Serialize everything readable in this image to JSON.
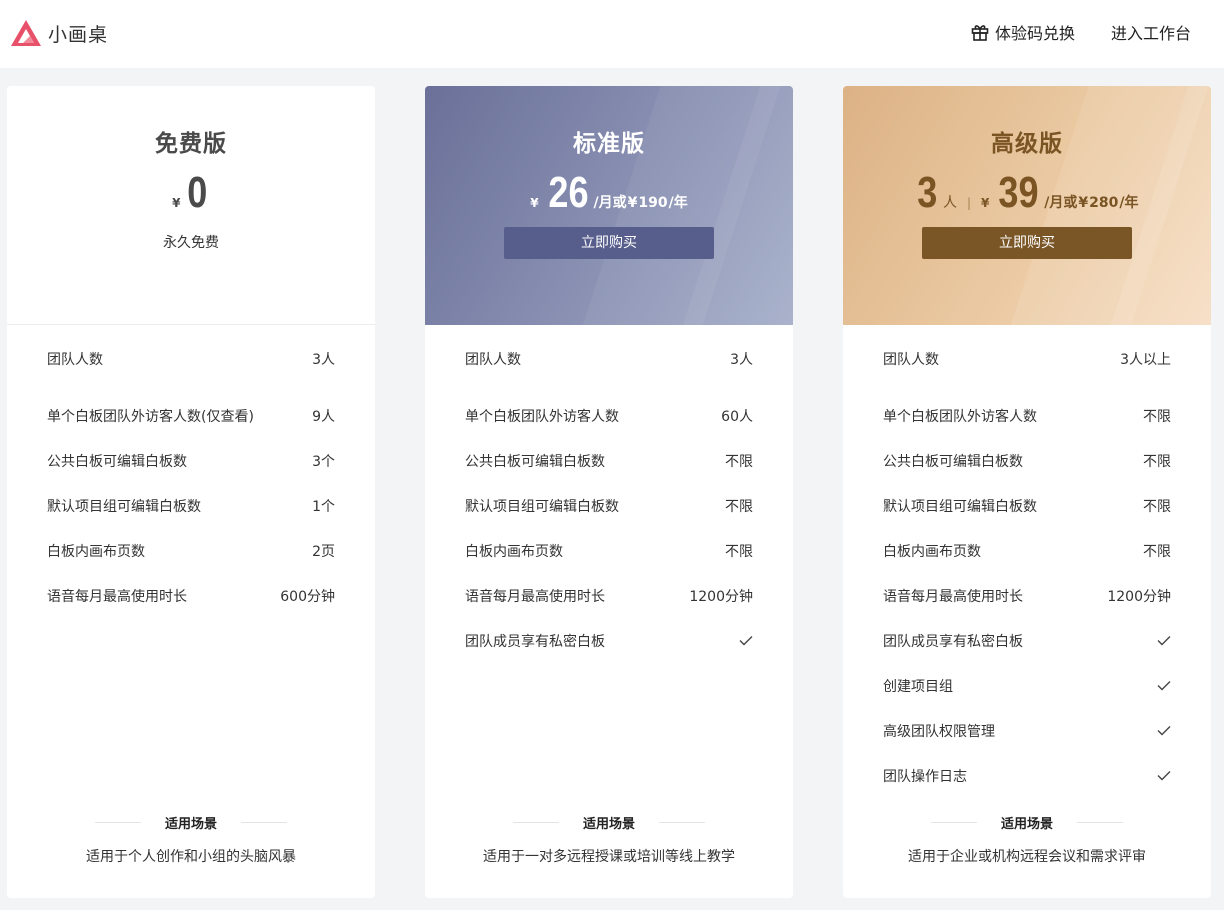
{
  "brand": {
    "name": "小画桌",
    "accent": "#e8516a"
  },
  "nav": {
    "redeem_label": "体验码兑换",
    "workbench_label": "进入工作台"
  },
  "colors": {
    "standard_button": "#585e8c",
    "pro_button": "#7a5526",
    "pro_text": "#7a5423"
  },
  "plans": {
    "free": {
      "name": "免费版",
      "currency": "¥",
      "price": "0",
      "note": "永久免费",
      "features": [
        {
          "label": "团队人数",
          "value": "3人"
        },
        {
          "label": "单个白板团队外访客人数(仅查看)",
          "value": "9人"
        },
        {
          "label": "公共白板可编辑白板数",
          "value": "3个"
        },
        {
          "label": "默认项目组可编辑白板数",
          "value": "1个"
        },
        {
          "label": "白板内画布页数",
          "value": "2页"
        },
        {
          "label": "语音每月最高使用时长",
          "value": "600分钟"
        }
      ],
      "scene_title": "适用场景",
      "scene_desc": "适用于个人创作和小组的头脑风暴"
    },
    "standard": {
      "name": "标准版",
      "currency": "¥",
      "price": "26",
      "per_month": "/月或",
      "currency2": "¥",
      "price_year": "190",
      "per_year": "/年",
      "buy_label": "立即购买",
      "features": [
        {
          "label": "团队人数",
          "value": "3人"
        },
        {
          "label": "单个白板团队外访客人数",
          "value": "60人"
        },
        {
          "label": "公共白板可编辑白板数",
          "value": "不限"
        },
        {
          "label": "默认项目组可编辑白板数",
          "value": "不限"
        },
        {
          "label": "白板内画布页数",
          "value": "不限"
        },
        {
          "label": "语音每月最高使用时长",
          "value": "1200分钟"
        },
        {
          "label": "团队成员享有私密白板",
          "value": "check-icon"
        }
      ],
      "scene_title": "适用场景",
      "scene_desc": "适用于一对多远程授课或培训等线上教学"
    },
    "pro": {
      "name": "高级版",
      "seats": "3",
      "seats_unit": "人",
      "separator": "|",
      "currency": "¥",
      "price": "39",
      "per_month": "/月或",
      "currency2": "¥",
      "price_year": "280",
      "per_year": "/年",
      "buy_label": "立即购买",
      "features": [
        {
          "label": "团队人数",
          "value": "3人以上"
        },
        {
          "label": "单个白板团队外访客人数",
          "value": "不限"
        },
        {
          "label": "公共白板可编辑白板数",
          "value": "不限"
        },
        {
          "label": "默认项目组可编辑白板数",
          "value": "不限"
        },
        {
          "label": "白板内画布页数",
          "value": "不限"
        },
        {
          "label": "语音每月最高使用时长",
          "value": "1200分钟"
        },
        {
          "label": "团队成员享有私密白板",
          "value": "check-icon"
        },
        {
          "label": "创建项目组",
          "value": "check-icon"
        },
        {
          "label": "高级团队权限管理",
          "value": "check-icon"
        },
        {
          "label": "团队操作日志",
          "value": "check-icon"
        }
      ],
      "scene_title": "适用场景",
      "scene_desc": "适用于企业或机构远程会议和需求评审"
    }
  }
}
